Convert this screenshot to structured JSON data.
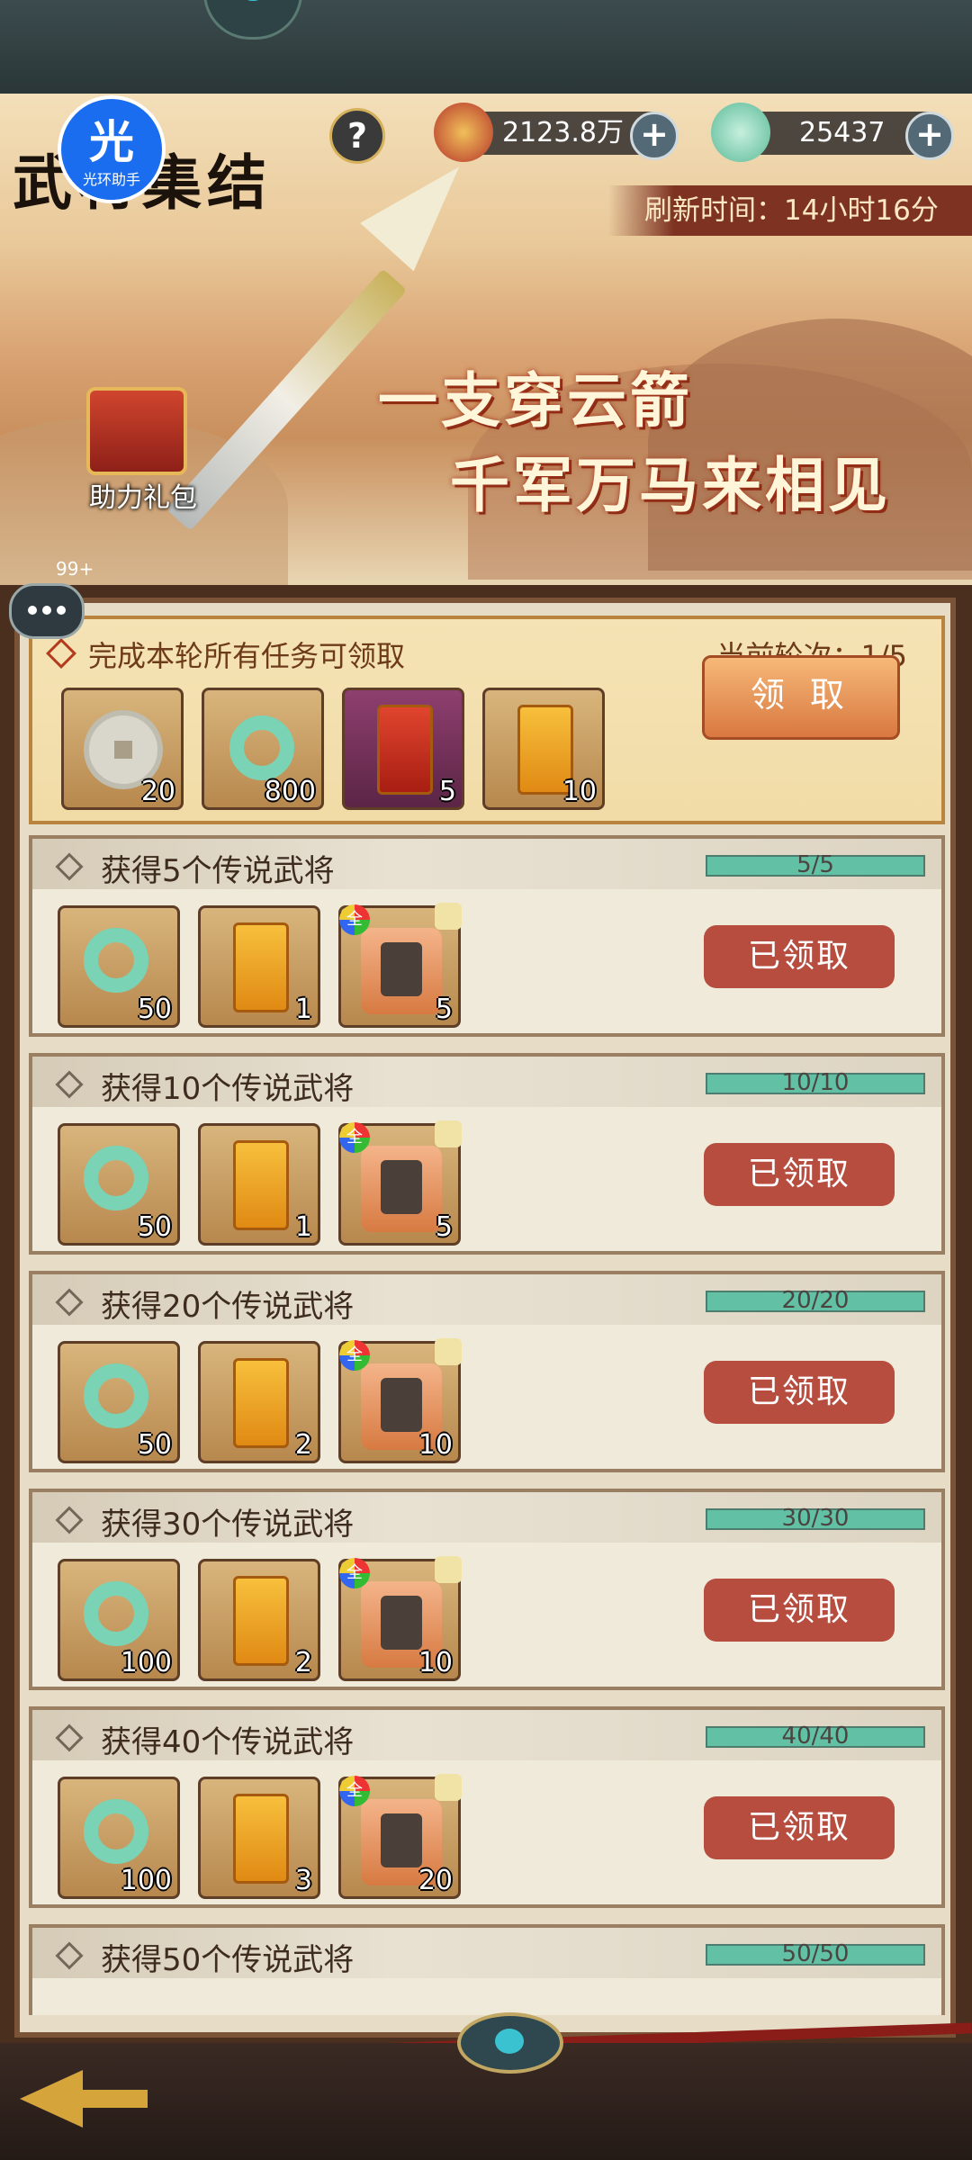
{
  "app": {
    "title": "武将集结",
    "logo_glyph": "光",
    "logo_text": "光环助手"
  },
  "resources": {
    "coins": "2123.8万",
    "jade": "25437"
  },
  "refresh": "刷新时间：14小时16分",
  "banner": {
    "slogan_line1": "一支穿云箭",
    "slogan_line2": "千军万马来相见",
    "gift_label": "助力礼包"
  },
  "chat": {
    "badge": "99+"
  },
  "round": {
    "header": "完成本轮所有任务可领取",
    "round_label": "当前轮次：1/5",
    "claim_label": "领 取",
    "rewards": [
      {
        "icon": "copper-coin-icon",
        "count": "20"
      },
      {
        "icon": "jade-dragon-icon",
        "count": "800"
      },
      {
        "icon": "red-token-icon",
        "count": "5"
      },
      {
        "icon": "gold-token-icon",
        "count": "10"
      }
    ]
  },
  "tasks": [
    {
      "title": "获得5个传说武将",
      "progress": "5/5",
      "progress_ratio": 1.0,
      "status": "已领取",
      "rewards": [
        {
          "icon": "jade-dragon-icon",
          "count": "50"
        },
        {
          "icon": "gold-token-icon",
          "count": "1"
        },
        {
          "icon": "general-fragment-icon",
          "count": "5",
          "badge": "全"
        }
      ]
    },
    {
      "title": "获得10个传说武将",
      "progress": "10/10",
      "progress_ratio": 1.0,
      "status": "已领取",
      "rewards": [
        {
          "icon": "jade-dragon-icon",
          "count": "50"
        },
        {
          "icon": "gold-token-icon",
          "count": "1"
        },
        {
          "icon": "general-fragment-icon",
          "count": "5",
          "badge": "全"
        }
      ]
    },
    {
      "title": "获得20个传说武将",
      "progress": "20/20",
      "progress_ratio": 1.0,
      "status": "已领取",
      "rewards": [
        {
          "icon": "jade-dragon-icon",
          "count": "50"
        },
        {
          "icon": "gold-token-icon",
          "count": "2"
        },
        {
          "icon": "general-fragment-icon",
          "count": "10",
          "badge": "全"
        }
      ]
    },
    {
      "title": "获得30个传说武将",
      "progress": "30/30",
      "progress_ratio": 1.0,
      "status": "已领取",
      "rewards": [
        {
          "icon": "jade-dragon-icon",
          "count": "100"
        },
        {
          "icon": "gold-token-icon",
          "count": "2"
        },
        {
          "icon": "general-fragment-icon",
          "count": "10",
          "badge": "全"
        }
      ]
    },
    {
      "title": "获得40个传说武将",
      "progress": "40/40",
      "progress_ratio": 1.0,
      "status": "已领取",
      "rewards": [
        {
          "icon": "jade-dragon-icon",
          "count": "100"
        },
        {
          "icon": "gold-token-icon",
          "count": "3"
        },
        {
          "icon": "general-fragment-icon",
          "count": "20",
          "badge": "全"
        }
      ]
    },
    {
      "title": "获得50个传说武将",
      "progress": "50/50",
      "progress_ratio": 1.0,
      "status": "",
      "rewards": []
    }
  ],
  "colors": {
    "accent": "#b64d3f",
    "progress": "#62c1a4",
    "panel": "#e7dcc5",
    "frame": "#4a2e1e"
  }
}
